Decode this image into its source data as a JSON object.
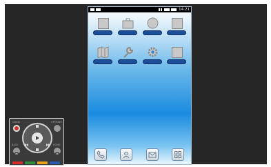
{
  "status_bar": {
    "time": "14:21"
  },
  "home": {
    "apps": [
      {
        "icon": "placeholder-app-icon"
      },
      {
        "icon": "briefcase-icon"
      },
      {
        "icon": "circle-app-icon"
      },
      {
        "icon": "placeholder-app-icon"
      },
      {
        "icon": "map-icon"
      },
      {
        "icon": "wrench-icon"
      },
      {
        "icon": "gear-icon"
      },
      {
        "icon": "placeholder-app-icon"
      }
    ],
    "dock": [
      {
        "icon": "phone-icon"
      },
      {
        "icon": "contacts-icon"
      },
      {
        "icon": "mail-icon"
      },
      {
        "icon": "apps-grid-icon"
      }
    ]
  },
  "remote": {
    "labels": {
      "guide": "GUIDE",
      "options": "OPTIONS",
      "back": "BACK",
      "home": "HOME"
    },
    "colors": [
      "#d42b2b",
      "#2f8d3a",
      "#e8a21b",
      "#2d5bb4"
    ]
  }
}
